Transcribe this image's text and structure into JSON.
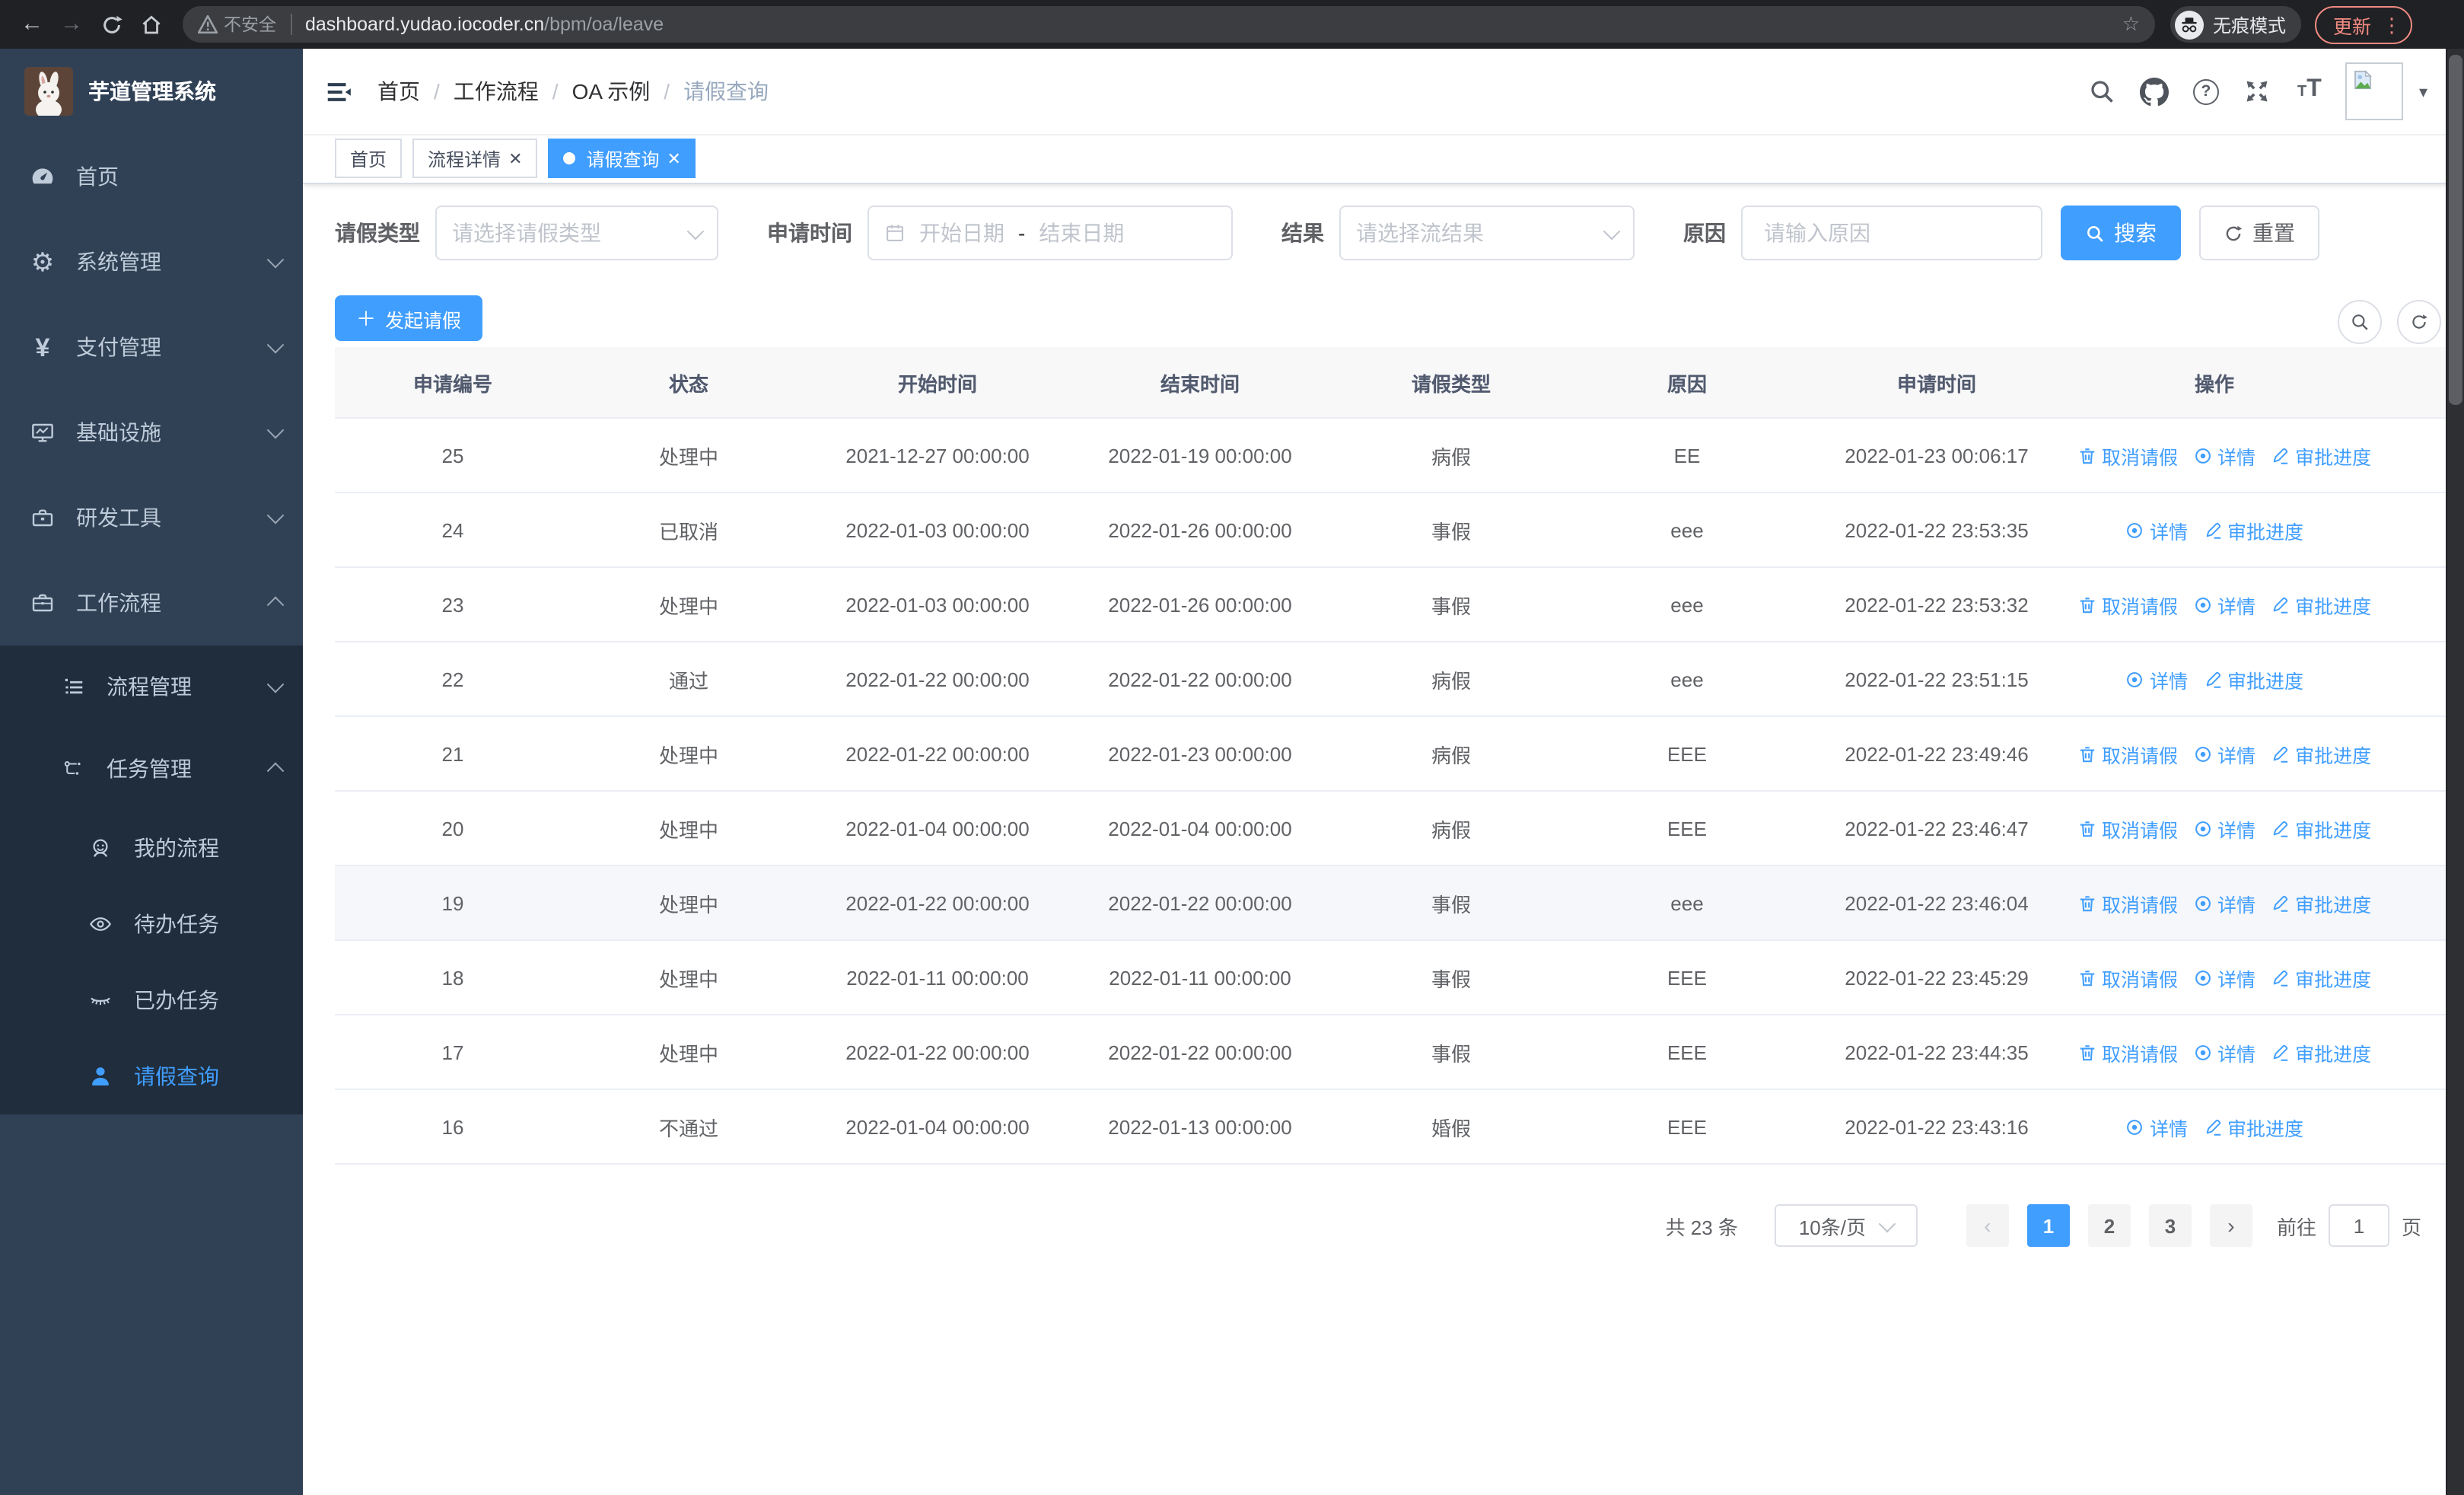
{
  "browser": {
    "security_label": "不安全",
    "url_host": "dashboard.yudao.iocoder.cn",
    "url_path": "/bpm/oa/leave",
    "incognito_label": "无痕模式",
    "update_label": "更新"
  },
  "colors": {
    "primary": "#409eff",
    "sidebar": "#304156",
    "sidebar_submenu": "#1f2d3d",
    "salmon": "#f28b82"
  },
  "sidebar": {
    "title": "芋道管理系统",
    "items": [
      {
        "label": "首页"
      },
      {
        "label": "系统管理"
      },
      {
        "label": "支付管理"
      },
      {
        "label": "基础设施"
      },
      {
        "label": "研发工具"
      },
      {
        "label": "工作流程"
      }
    ],
    "groups": [
      {
        "label": "流程管理"
      },
      {
        "label": "任务管理"
      }
    ],
    "leaves": [
      {
        "label": "我的流程"
      },
      {
        "label": "待办任务"
      },
      {
        "label": "已办任务"
      },
      {
        "label": "请假查询"
      }
    ]
  },
  "navbar": {
    "breadcrumb": [
      "首页",
      "工作流程",
      "OA 示例",
      "请假查询"
    ]
  },
  "tabs": [
    {
      "label": "首页"
    },
    {
      "label": "流程详情"
    },
    {
      "label": "请假查询"
    }
  ],
  "filters": {
    "type_label": "请假类型",
    "type_placeholder": "请选择请假类型",
    "time_label": "申请时间",
    "start_placeholder": "开始日期",
    "range_separator": "-",
    "end_placeholder": "结束日期",
    "result_label": "结果",
    "result_placeholder": "请选择流结果",
    "reason_label": "原因",
    "reason_placeholder": "请输入原因",
    "search_label": "搜索",
    "reset_label": "重置"
  },
  "toolbar": {
    "create_label": "发起请假"
  },
  "table": {
    "headers": [
      "申请编号",
      "状态",
      "开始时间",
      "结束时间",
      "请假类型",
      "原因",
      "申请时间",
      "操作"
    ],
    "action_labels": {
      "cancel": "取消请假",
      "detail": "详情",
      "progress": "审批进度"
    },
    "rows": [
      {
        "id": "25",
        "status": "处理中",
        "start": "2021-12-27 00:00:00",
        "end": "2022-01-19 00:00:00",
        "type": "病假",
        "reason": "EE",
        "apply_time": "2022-01-23 00:06:17",
        "actions": [
          "cancel",
          "detail",
          "progress"
        ]
      },
      {
        "id": "24",
        "status": "已取消",
        "start": "2022-01-03 00:00:00",
        "end": "2022-01-26 00:00:00",
        "type": "事假",
        "reason": "eee",
        "apply_time": "2022-01-22 23:53:35",
        "actions": [
          "detail",
          "progress"
        ]
      },
      {
        "id": "23",
        "status": "处理中",
        "start": "2022-01-03 00:00:00",
        "end": "2022-01-26 00:00:00",
        "type": "事假",
        "reason": "eee",
        "apply_time": "2022-01-22 23:53:32",
        "actions": [
          "cancel",
          "detail",
          "progress"
        ]
      },
      {
        "id": "22",
        "status": "通过",
        "start": "2022-01-22 00:00:00",
        "end": "2022-01-22 00:00:00",
        "type": "病假",
        "reason": "eee",
        "apply_time": "2022-01-22 23:51:15",
        "actions": [
          "detail",
          "progress"
        ]
      },
      {
        "id": "21",
        "status": "处理中",
        "start": "2022-01-22 00:00:00",
        "end": "2022-01-23 00:00:00",
        "type": "病假",
        "reason": "EEE",
        "apply_time": "2022-01-22 23:49:46",
        "actions": [
          "cancel",
          "detail",
          "progress"
        ]
      },
      {
        "id": "20",
        "status": "处理中",
        "start": "2022-01-04 00:00:00",
        "end": "2022-01-04 00:00:00",
        "type": "病假",
        "reason": "EEE",
        "apply_time": "2022-01-22 23:46:47",
        "actions": [
          "cancel",
          "detail",
          "progress"
        ]
      },
      {
        "id": "19",
        "status": "处理中",
        "start": "2022-01-22 00:00:00",
        "end": "2022-01-22 00:00:00",
        "type": "事假",
        "reason": "eee",
        "apply_time": "2022-01-22 23:46:04",
        "actions": [
          "cancel",
          "detail",
          "progress"
        ],
        "highlighted": true
      },
      {
        "id": "18",
        "status": "处理中",
        "start": "2022-01-11 00:00:00",
        "end": "2022-01-11 00:00:00",
        "type": "事假",
        "reason": "EEE",
        "apply_time": "2022-01-22 23:45:29",
        "actions": [
          "cancel",
          "detail",
          "progress"
        ]
      },
      {
        "id": "17",
        "status": "处理中",
        "start": "2022-01-22 00:00:00",
        "end": "2022-01-22 00:00:00",
        "type": "事假",
        "reason": "EEE",
        "apply_time": "2022-01-22 23:44:35",
        "actions": [
          "cancel",
          "detail",
          "progress"
        ]
      },
      {
        "id": "16",
        "status": "不通过",
        "start": "2022-01-04 00:00:00",
        "end": "2022-01-13 00:00:00",
        "type": "婚假",
        "reason": "EEE",
        "apply_time": "2022-01-22 23:43:16",
        "actions": [
          "detail",
          "progress"
        ]
      }
    ]
  },
  "pagination": {
    "total": "共 23 条",
    "page_size": "10条/页",
    "pages": [
      "1",
      "2",
      "3"
    ],
    "active_page": "1",
    "goto_label": "前往",
    "goto_value": "1",
    "page_suffix": "页"
  }
}
